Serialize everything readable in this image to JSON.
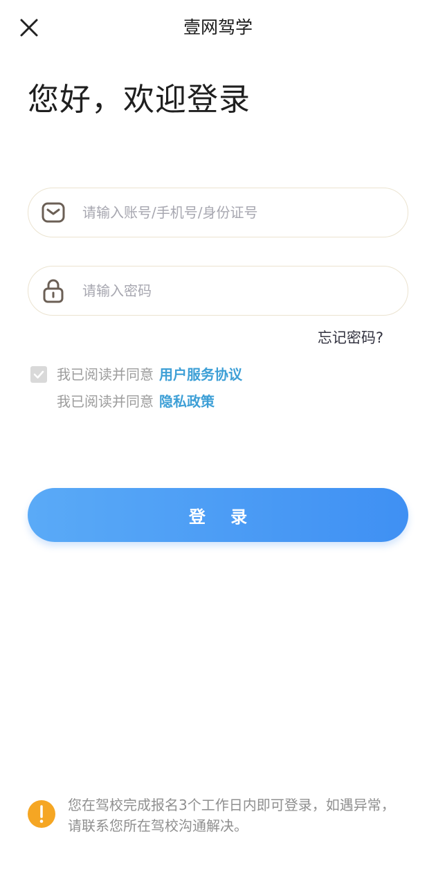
{
  "header": {
    "title": "壹网驾学",
    "close_icon": "close-icon"
  },
  "welcome": {
    "text": "您好，欢迎登录"
  },
  "form": {
    "account": {
      "icon": "mail-icon",
      "placeholder": "请输入账号/手机号/身份证号",
      "value": ""
    },
    "password": {
      "icon": "lock-icon",
      "placeholder": "请输入密码",
      "value": ""
    },
    "forgot_label": "忘记密码?"
  },
  "agreements": {
    "checked": true,
    "prefix1": "我已阅读并同意",
    "link1": "用户服务协议",
    "prefix2": "我已阅读并同意",
    "link2": "隐私政策"
  },
  "login_button": {
    "label": "登 录"
  },
  "notice": {
    "icon": "warning-icon",
    "text": "您在驾校完成报名3个工作日内即可登录，如遇异常，请联系您所在驾校沟通解决。"
  },
  "colors": {
    "accent": "#4296f4",
    "link": "#3d9fd6",
    "input_border": "#ebe3d0",
    "warning": "#f5a623"
  }
}
